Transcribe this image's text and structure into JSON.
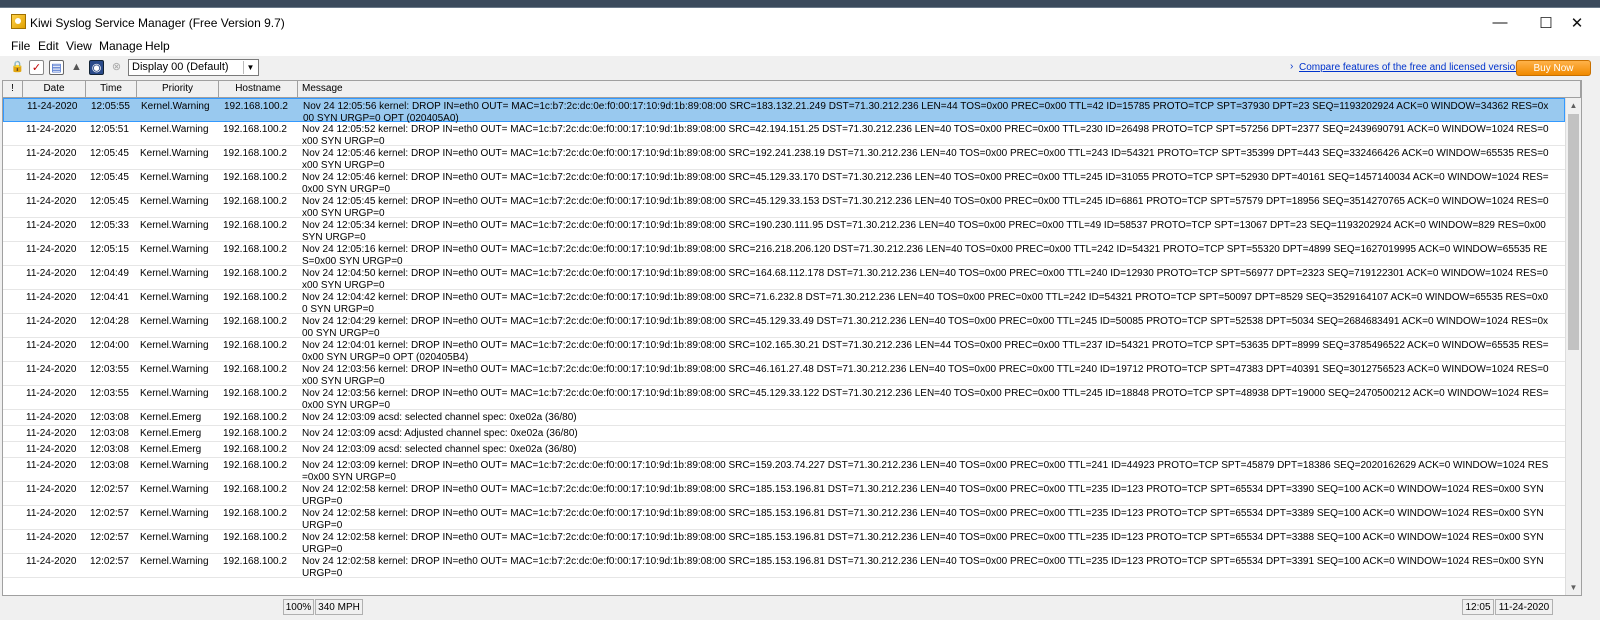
{
  "window": {
    "title": "Kiwi Syslog Service Manager (Free Version 9.7)",
    "controls": {
      "minimize": "—",
      "maximize": "☐",
      "close": "✕"
    }
  },
  "menu": [
    "File",
    "Edit",
    "View",
    "Manage",
    "Help"
  ],
  "toolbar": {
    "icons": [
      "lock-icon",
      "checklist-icon",
      "chart-icon",
      "warning-icon",
      "globe-icon",
      "stop-icon"
    ],
    "display_select": "Display 00 (Default)",
    "compare_arrow": "›",
    "compare_link": "Compare features of the free and licensed versions",
    "buy_now": "Buy Now"
  },
  "grid": {
    "columns": [
      "!",
      "Date",
      "Time",
      "Priority",
      "Hostname",
      "Message"
    ],
    "rows": [
      {
        "date": "11-24-2020",
        "time": "12:05:55",
        "priority": "Kernel.Warning",
        "hostname": "192.168.100.2",
        "message": "Nov 24 12:05:56 kernel: DROP IN=eth0 OUT= MAC=1c:b7:2c:dc:0e:f0:00:17:10:9d:1b:89:08:00 SRC=183.132.21.249 DST=71.30.212.236 LEN=44 TOS=0x00 PREC=0x00 TTL=42 ID=15785 PROTO=TCP SPT=37930 DPT=23 SEQ=1193202924 ACK=0 WINDOW=34362 RES=0x00 SYN URGP=0 OPT (020405A0)",
        "selected": true
      },
      {
        "date": "11-24-2020",
        "time": "12:05:51",
        "priority": "Kernel.Warning",
        "hostname": "192.168.100.2",
        "message": "Nov 24 12:05:52 kernel: DROP IN=eth0 OUT= MAC=1c:b7:2c:dc:0e:f0:00:17:10:9d:1b:89:08:00 SRC=42.194.151.25 DST=71.30.212.236 LEN=40 TOS=0x00 PREC=0x00 TTL=230 ID=26498 PROTO=TCP SPT=57256 DPT=2377 SEQ=2439690791 ACK=0 WINDOW=1024 RES=0x00 SYN URGP=0"
      },
      {
        "date": "11-24-2020",
        "time": "12:05:45",
        "priority": "Kernel.Warning",
        "hostname": "192.168.100.2",
        "message": "Nov 24 12:05:46 kernel: DROP IN=eth0 OUT= MAC=1c:b7:2c:dc:0e:f0:00:17:10:9d:1b:89:08:00 SRC=192.241.238.19 DST=71.30.212.236 LEN=40 TOS=0x00 PREC=0x00 TTL=243 ID=54321 PROTO=TCP SPT=35399 DPT=443 SEQ=332466426 ACK=0 WINDOW=65535 RES=0x00 SYN URGP=0"
      },
      {
        "date": "11-24-2020",
        "time": "12:05:45",
        "priority": "Kernel.Warning",
        "hostname": "192.168.100.2",
        "message": "Nov 24 12:05:46 kernel: DROP IN=eth0 OUT= MAC=1c:b7:2c:dc:0e:f0:00:17:10:9d:1b:89:08:00 SRC=45.129.33.170 DST=71.30.212.236 LEN=40 TOS=0x00 PREC=0x00 TTL=245 ID=31055 PROTO=TCP SPT=52930 DPT=40161 SEQ=1457140034 ACK=0 WINDOW=1024 RES=0x00 SYN URGP=0"
      },
      {
        "date": "11-24-2020",
        "time": "12:05:45",
        "priority": "Kernel.Warning",
        "hostname": "192.168.100.2",
        "message": "Nov 24 12:05:45 kernel: DROP IN=eth0 OUT= MAC=1c:b7:2c:dc:0e:f0:00:17:10:9d:1b:89:08:00 SRC=45.129.33.153 DST=71.30.212.236 LEN=40 TOS=0x00 PREC=0x00 TTL=245 ID=6861 PROTO=TCP SPT=57579 DPT=18956 SEQ=3514270765 ACK=0 WINDOW=1024 RES=0x00 SYN URGP=0"
      },
      {
        "date": "11-24-2020",
        "time": "12:05:33",
        "priority": "Kernel.Warning",
        "hostname": "192.168.100.2",
        "message": "Nov 24 12:05:34 kernel: DROP IN=eth0 OUT= MAC=1c:b7:2c:dc:0e:f0:00:17:10:9d:1b:89:08:00 SRC=190.230.111.95 DST=71.30.212.236 LEN=40 TOS=0x00 PREC=0x00 TTL=49 ID=58537 PROTO=TCP SPT=13067 DPT=23 SEQ=1193202924 ACK=0 WINDOW=829 RES=0x00 SYN URGP=0"
      },
      {
        "date": "11-24-2020",
        "time": "12:05:15",
        "priority": "Kernel.Warning",
        "hostname": "192.168.100.2",
        "message": "Nov 24 12:05:16 kernel: DROP IN=eth0 OUT= MAC=1c:b7:2c:dc:0e:f0:00:17:10:9d:1b:89:08:00 SRC=216.218.206.120 DST=71.30.212.236 LEN=40 TOS=0x00 PREC=0x00 TTL=242 ID=54321 PROTO=TCP SPT=55320 DPT=4899 SEQ=1627019995 ACK=0 WINDOW=65535 RES=0x00 SYN URGP=0"
      },
      {
        "date": "11-24-2020",
        "time": "12:04:49",
        "priority": "Kernel.Warning",
        "hostname": "192.168.100.2",
        "message": "Nov 24 12:04:50 kernel: DROP IN=eth0 OUT= MAC=1c:b7:2c:dc:0e:f0:00:17:10:9d:1b:89:08:00 SRC=164.68.112.178 DST=71.30.212.236 LEN=40 TOS=0x00 PREC=0x00 TTL=240 ID=12930 PROTO=TCP SPT=56977 DPT=2323 SEQ=719122301 ACK=0 WINDOW=1024 RES=0x00 SYN URGP=0"
      },
      {
        "date": "11-24-2020",
        "time": "12:04:41",
        "priority": "Kernel.Warning",
        "hostname": "192.168.100.2",
        "message": "Nov 24 12:04:42 kernel: DROP IN=eth0 OUT= MAC=1c:b7:2c:dc:0e:f0:00:17:10:9d:1b:89:08:00 SRC=71.6.232.8 DST=71.30.212.236 LEN=40 TOS=0x00 PREC=0x00 TTL=242 ID=54321 PROTO=TCP SPT=50097 DPT=8529 SEQ=3529164107 ACK=0 WINDOW=65535 RES=0x00 SYN URGP=0"
      },
      {
        "date": "11-24-2020",
        "time": "12:04:28",
        "priority": "Kernel.Warning",
        "hostname": "192.168.100.2",
        "message": "Nov 24 12:04:29 kernel: DROP IN=eth0 OUT= MAC=1c:b7:2c:dc:0e:f0:00:17:10:9d:1b:89:08:00 SRC=45.129.33.49 DST=71.30.212.236 LEN=40 TOS=0x00 PREC=0x00 TTL=245 ID=50085 PROTO=TCP SPT=52538 DPT=5034 SEQ=2684683491 ACK=0 WINDOW=1024 RES=0x00 SYN URGP=0"
      },
      {
        "date": "11-24-2020",
        "time": "12:04:00",
        "priority": "Kernel.Warning",
        "hostname": "192.168.100.2",
        "message": "Nov 24 12:04:01 kernel: DROP IN=eth0 OUT= MAC=1c:b7:2c:dc:0e:f0:00:17:10:9d:1b:89:08:00 SRC=102.165.30.21 DST=71.30.212.236 LEN=44 TOS=0x00 PREC=0x00 TTL=237 ID=54321 PROTO=TCP SPT=53635 DPT=8999 SEQ=3785496522 ACK=0 WINDOW=65535 RES=0x00 SYN URGP=0 OPT (020405B4)"
      },
      {
        "date": "11-24-2020",
        "time": "12:03:55",
        "priority": "Kernel.Warning",
        "hostname": "192.168.100.2",
        "message": "Nov 24 12:03:56 kernel: DROP IN=eth0 OUT= MAC=1c:b7:2c:dc:0e:f0:00:17:10:9d:1b:89:08:00 SRC=46.161.27.48 DST=71.30.212.236 LEN=40 TOS=0x00 PREC=0x00 TTL=240 ID=19712 PROTO=TCP SPT=47383 DPT=40391 SEQ=3012756523 ACK=0 WINDOW=1024 RES=0x00 SYN URGP=0"
      },
      {
        "date": "11-24-2020",
        "time": "12:03:55",
        "priority": "Kernel.Warning",
        "hostname": "192.168.100.2",
        "message": "Nov 24 12:03:56 kernel: DROP IN=eth0 OUT= MAC=1c:b7:2c:dc:0e:f0:00:17:10:9d:1b:89:08:00 SRC=45.129.33.122 DST=71.30.212.236 LEN=40 TOS=0x00 PREC=0x00 TTL=245 ID=18848 PROTO=TCP SPT=48938 DPT=19000 SEQ=2470500212 ACK=0 WINDOW=1024 RES=0x00 SYN URGP=0"
      },
      {
        "date": "11-24-2020",
        "time": "12:03:08",
        "priority": "Kernel.Emerg",
        "hostname": "192.168.100.2",
        "message": "Nov 24 12:03:09 acsd: selected channel spec: 0xe02a (36/80)"
      },
      {
        "date": "11-24-2020",
        "time": "12:03:08",
        "priority": "Kernel.Emerg",
        "hostname": "192.168.100.2",
        "message": "Nov 24 12:03:09 acsd: Adjusted channel spec: 0xe02a (36/80)"
      },
      {
        "date": "11-24-2020",
        "time": "12:03:08",
        "priority": "Kernel.Emerg",
        "hostname": "192.168.100.2",
        "message": "Nov 24 12:03:09 acsd: selected channel spec: 0xe02a (36/80)"
      },
      {
        "date": "11-24-2020",
        "time": "12:03:08",
        "priority": "Kernel.Warning",
        "hostname": "192.168.100.2",
        "message": "Nov 24 12:03:09 kernel: DROP IN=eth0 OUT= MAC=1c:b7:2c:dc:0e:f0:00:17:10:9d:1b:89:08:00 SRC=159.203.74.227 DST=71.30.212.236 LEN=40 TOS=0x00 PREC=0x00 TTL=241 ID=44923 PROTO=TCP SPT=45879 DPT=18386 SEQ=2020162629 ACK=0 WINDOW=1024 RES=0x00 SYN URGP=0"
      },
      {
        "date": "11-24-2020",
        "time": "12:02:57",
        "priority": "Kernel.Warning",
        "hostname": "192.168.100.2",
        "message": "Nov 24 12:02:58 kernel: DROP IN=eth0 OUT= MAC=1c:b7:2c:dc:0e:f0:00:17:10:9d:1b:89:08:00 SRC=185.153.196.81 DST=71.30.212.236 LEN=40 TOS=0x00 PREC=0x00 TTL=235 ID=123 PROTO=TCP SPT=65534 DPT=3390 SEQ=100 ACK=0 WINDOW=1024 RES=0x00 SYN URGP=0"
      },
      {
        "date": "11-24-2020",
        "time": "12:02:57",
        "priority": "Kernel.Warning",
        "hostname": "192.168.100.2",
        "message": "Nov 24 12:02:58 kernel: DROP IN=eth0 OUT= MAC=1c:b7:2c:dc:0e:f0:00:17:10:9d:1b:89:08:00 SRC=185.153.196.81 DST=71.30.212.236 LEN=40 TOS=0x00 PREC=0x00 TTL=235 ID=123 PROTO=TCP SPT=65534 DPT=3389 SEQ=100 ACK=0 WINDOW=1024 RES=0x00 SYN URGP=0"
      },
      {
        "date": "11-24-2020",
        "time": "12:02:57",
        "priority": "Kernel.Warning",
        "hostname": "192.168.100.2",
        "message": "Nov 24 12:02:58 kernel: DROP IN=eth0 OUT= MAC=1c:b7:2c:dc:0e:f0:00:17:10:9d:1b:89:08:00 SRC=185.153.196.81 DST=71.30.212.236 LEN=40 TOS=0x00 PREC=0x00 TTL=235 ID=123 PROTO=TCP SPT=65534 DPT=3388 SEQ=100 ACK=0 WINDOW=1024 RES=0x00 SYN URGP=0"
      },
      {
        "date": "11-24-2020",
        "time": "12:02:57",
        "priority": "Kernel.Warning",
        "hostname": "192.168.100.2",
        "message": "Nov 24 12:02:58 kernel: DROP IN=eth0 OUT= MAC=1c:b7:2c:dc:0e:f0:00:17:10:9d:1b:89:08:00 SRC=185.153.196.81 DST=71.30.212.236 LEN=40 TOS=0x00 PREC=0x00 TTL=235 ID=123 PROTO=TCP SPT=65534 DPT=3391 SEQ=100 ACK=0 WINDOW=1024 RES=0x00 SYN URGP=0"
      }
    ]
  },
  "status": {
    "zoom": "100%",
    "rate": "340 MPH",
    "time": "12:05",
    "date": "11-24-2020"
  },
  "colors": {
    "selected_row": "#99c9ef",
    "link": "#0033cc",
    "buy_now": "#f5a000"
  }
}
